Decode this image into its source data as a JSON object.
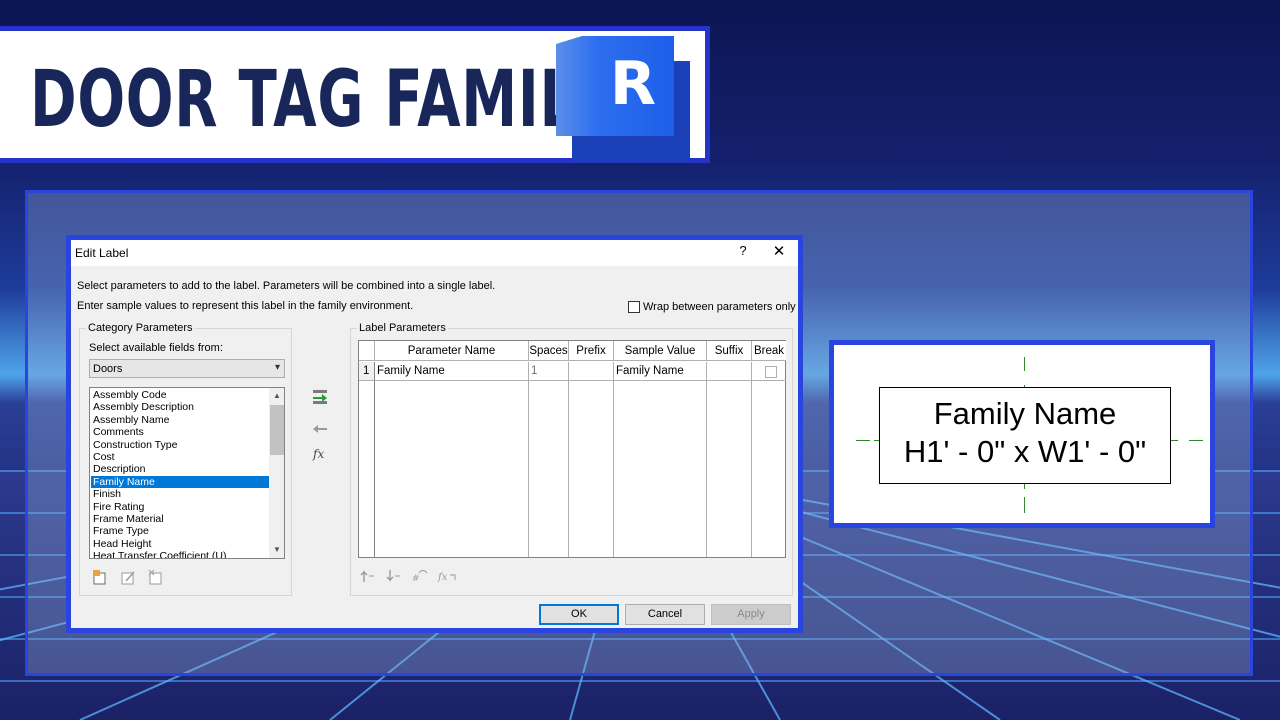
{
  "banner": {
    "title": "DOOR TAG FAMILY",
    "logo_letter": "R",
    "logo_icon": "revit-logo-icon"
  },
  "colors": {
    "frame_blue": "#2a44e0",
    "title_navy": "#18265a",
    "selection_blue": "#0078d7"
  },
  "dialog": {
    "title": "Edit Label",
    "help_label": "?",
    "close_label": "✕",
    "instruction_1": "Select parameters to add to the label.  Parameters will be combined into a single label.",
    "instruction_2": "Enter sample values to represent this label in the family environment.",
    "wrap_label": "Wrap between parameters only",
    "wrap_checked": false,
    "category": {
      "group_label": "Category Parameters",
      "select_label": "Select available fields from:",
      "selected_category": "Doors",
      "fields": [
        "Assembly Code",
        "Assembly Description",
        "Assembly Name",
        "Comments",
        "Construction Type",
        "Cost",
        "Description",
        "Family Name",
        "Finish",
        "Fire Rating",
        "Frame Material",
        "Frame Type",
        "Head Height",
        "Heat Transfer Coefficient (U)"
      ],
      "selected_field": "Family Name"
    },
    "label_params": {
      "group_label": "Label Parameters",
      "columns": [
        "Parameter Name",
        "Spaces",
        "Prefix",
        "Sample Value",
        "Suffix",
        "Break"
      ],
      "rows": [
        {
          "num": "1",
          "parameter_name": "Family Name",
          "spaces": "1",
          "prefix": "",
          "sample_value": "Family Name",
          "suffix": "",
          "break": false
        }
      ]
    },
    "buttons": {
      "ok": "OK",
      "cancel": "Cancel",
      "apply": "Apply"
    }
  },
  "preview": {
    "line1": "Family Name",
    "line2": "H1' - 0\" x W1' - 0\""
  }
}
